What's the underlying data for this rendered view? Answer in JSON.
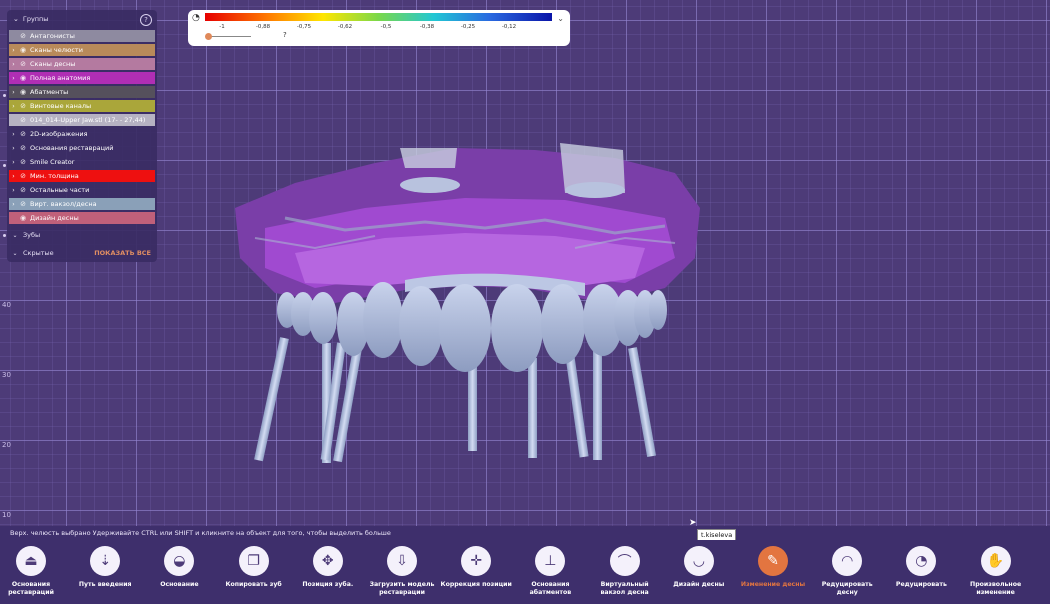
{
  "ruler": {
    "labels": [
      "40",
      "30",
      "20",
      "10"
    ]
  },
  "groups": {
    "header": "Группы",
    "show_all": "ПОКАЗАТЬ ВСЕ",
    "items": [
      {
        "label": "Антагонисты",
        "color": "#8e8aa0",
        "arrow": false,
        "icon": "eye-off-icon"
      },
      {
        "label": "Сканы челюсти",
        "color": "#b88a5a",
        "arrow": true,
        "icon": "eye-icon"
      },
      {
        "label": "Сканы десны",
        "color": "#b47aa0",
        "arrow": true,
        "icon": "eye-off-icon"
      },
      {
        "label": "Полная анатомия",
        "color": "#b02eb4",
        "arrow": true,
        "icon": "eye-icon"
      },
      {
        "label": "Абатменты",
        "color": "#55505c",
        "arrow": true,
        "icon": "eye-icon"
      },
      {
        "label": "Винтовые каналы",
        "color": "#aaa63a",
        "arrow": true,
        "icon": "eye-off-icon"
      },
      {
        "label": "014_014-Upper Jaw.stl (17- - 27,44)",
        "color": "#b6b2c2",
        "arrow": false,
        "icon": "eye-off-icon"
      },
      {
        "label": "2D-изображения",
        "color": "",
        "arrow": true,
        "icon": "eye-off-icon"
      },
      {
        "label": "Основания реставраций",
        "color": "",
        "arrow": true,
        "icon": "eye-off-icon"
      },
      {
        "label": "Smile Creator",
        "color": "",
        "arrow": true,
        "icon": "eye-off-icon"
      },
      {
        "label": "Мин. толщина",
        "color": "#ee1010",
        "arrow": true,
        "icon": "eye-off-icon"
      },
      {
        "label": "Остальные части",
        "color": "",
        "arrow": true,
        "icon": "eye-off-icon"
      },
      {
        "label": "Вирт. вакзол/десна",
        "color": "#8aa0b8",
        "arrow": true,
        "icon": "eye-off-icon"
      },
      {
        "label": "Дизайн десны",
        "color": "#c0607a",
        "arrow": false,
        "icon": "eye-icon"
      }
    ],
    "teeth": "Зубы",
    "hidden": "Скрытые"
  },
  "colorscale": {
    "ticks": [
      "-1",
      "-0,88",
      "-0,75",
      "-0,62",
      "-0,5",
      "-0,38",
      "-0,25",
      "-0,12"
    ],
    "question": "?"
  },
  "status": {
    "text": "Верх. челюсть выбрано Удерживайте CTRL или SHIFT и кликните на объект для того, чтобы выделить больше",
    "tooltip": "t.kiseleva"
  },
  "toolbar": [
    {
      "label": "Основания реставраций",
      "icon": "implant-base-icon",
      "glyph": "⏏",
      "active": false
    },
    {
      "label": "Путь введения",
      "icon": "insertion-path-icon",
      "glyph": "⇣",
      "active": false
    },
    {
      "label": "Основание",
      "icon": "base-icon",
      "glyph": "◒",
      "active": false
    },
    {
      "label": "Копировать зуб",
      "icon": "copy-tooth-icon",
      "glyph": "❐",
      "active": false
    },
    {
      "label": "Позиция зуба.",
      "icon": "tooth-position-icon",
      "glyph": "✥",
      "active": false
    },
    {
      "label": "Загрузить модель реставрации",
      "icon": "load-restoration-icon",
      "glyph": "⇩",
      "active": false
    },
    {
      "label": "Коррекция позиции",
      "icon": "position-correction-icon",
      "glyph": "✛",
      "active": false
    },
    {
      "label": "Основания абатментов",
      "icon": "abutment-base-icon",
      "glyph": "⊥",
      "active": false
    },
    {
      "label": "Виртуальный вакзол десна",
      "icon": "virtual-gingiva-icon",
      "glyph": "⌒",
      "active": false
    },
    {
      "label": "Дизайн десны",
      "icon": "gingiva-design-icon",
      "glyph": "◡",
      "active": false
    },
    {
      "label": "Изменение десны",
      "icon": "gingiva-edit-icon",
      "glyph": "✎",
      "active": true
    },
    {
      "label": "Редуцировать десну",
      "icon": "reduce-gingiva-icon",
      "glyph": "◠",
      "active": false
    },
    {
      "label": "Редуцировать",
      "icon": "reduce-icon",
      "glyph": "◔",
      "active": false
    },
    {
      "label": "Произвольное изменение",
      "icon": "freeform-icon",
      "glyph": "✋",
      "active": false
    }
  ]
}
